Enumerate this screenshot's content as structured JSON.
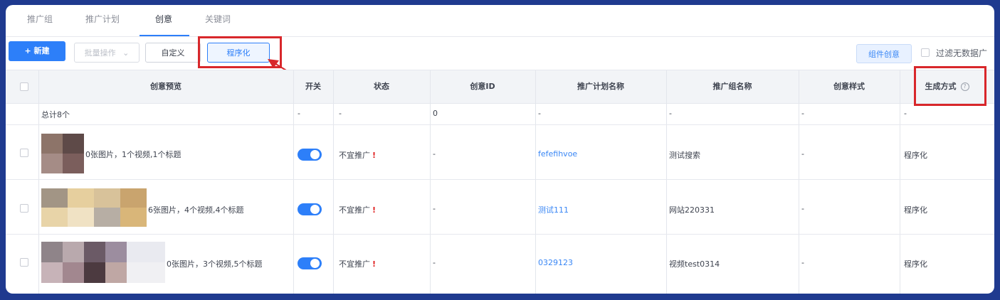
{
  "tabs": [
    "推广组",
    "推广计划",
    "创意",
    "关键词"
  ],
  "active_tab": "创意",
  "toolbar": {
    "new_label": "+ 新建",
    "batch_label": "批量操作",
    "custom_label": "自定义",
    "programmatic_label": "程序化",
    "combo_label": "组件创意",
    "filter_label": "过滤无数据广"
  },
  "table": {
    "headers": [
      "创意预览",
      "开关",
      "状态",
      "创意ID",
      "推广计划名称",
      "推广组名称",
      "创意样式",
      "生成方式"
    ],
    "summary": {
      "label": "总计8个",
      "switch": "-",
      "status": "-",
      "id": "0",
      "plan": "-",
      "group": "-",
      "style": "-",
      "method": "-"
    },
    "rows": [
      {
        "preview_text": "0张图片，1个视频,1个标题",
        "switch_on": true,
        "status": "不宜推广",
        "status_mark": "!",
        "id": "-",
        "plan": "fefefihvoe",
        "group": "测试搜索",
        "style": "-",
        "method": "程序化"
      },
      {
        "preview_text": "6张图片，4个视频,4个标题",
        "switch_on": true,
        "status": "不宜推广",
        "status_mark": "!",
        "id": "-",
        "plan": "测试111",
        "group": "网站220331",
        "style": "-",
        "method": "程序化"
      },
      {
        "preview_text": "0张图片，3个视频,5个标题",
        "switch_on": true,
        "status": "不宜推广",
        "status_mark": "!",
        "id": "-",
        "plan": "0329123",
        "group": "视频test0314",
        "style": "-",
        "method": "程序化"
      }
    ]
  },
  "colors": {
    "accent": "#2d7ff9",
    "highlight_red": "#d8272b",
    "frame_bg": "#1f3a8f"
  }
}
